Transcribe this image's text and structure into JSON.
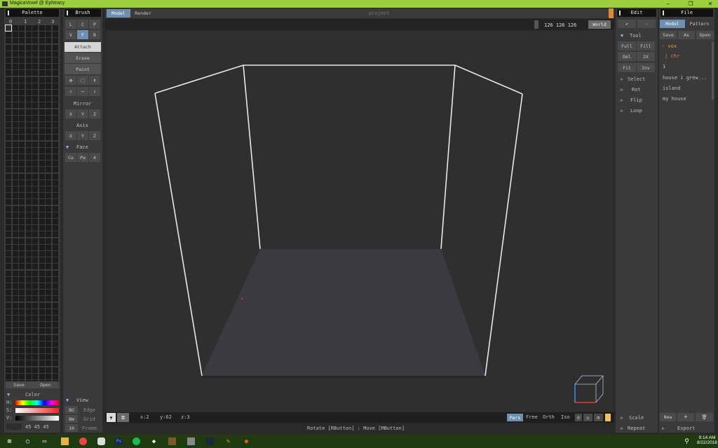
{
  "window": {
    "title": "MagicaVoxel @ Ephtracy",
    "minimize": "–",
    "maximize": "❐",
    "close": "✕"
  },
  "palette": {
    "title": "Palette",
    "tabs": [
      "0",
      "1",
      "2",
      "3"
    ],
    "save": "Save",
    "open": "Open"
  },
  "color": {
    "title": "Color",
    "h": "H:",
    "s": "S:",
    "v": "V:",
    "rgb": "45 45 45"
  },
  "brush": {
    "title": "Brush",
    "row1": [
      "L",
      "C",
      "P"
    ],
    "row2": [
      "V",
      "F",
      "B"
    ],
    "modes": [
      "Attach",
      "Erase",
      "Paint"
    ],
    "mirror": "Mirror",
    "mirror_axes": [
      "X",
      "Y",
      "Z"
    ],
    "axis": "Axis",
    "axis_axes": [
      "X",
      "Y",
      "Z"
    ],
    "face": "Face",
    "face_btns": [
      "Co",
      "Pa",
      "4"
    ]
  },
  "view": {
    "title": "View",
    "rows": [
      {
        "k": "BG",
        "v": "Edge"
      },
      {
        "k": "BW",
        "v": "Grid"
      },
      {
        "k": "10",
        "v": "Frame"
      }
    ]
  },
  "tabs": {
    "model": "Model",
    "render": "Render",
    "project": "project"
  },
  "size": {
    "value": "126 126 126",
    "world": "World"
  },
  "status": {
    "x": "x:2",
    "y": "y:62",
    "z": "z:3",
    "hint": "Rotate [RButton] : Move [MButton]"
  },
  "cam": {
    "pers": "Pers",
    "free": "Free",
    "orth": "Orth",
    "iso": "Iso",
    "zero": "0"
  },
  "edit": {
    "title": "Edit",
    "tool": "Tool",
    "grid": [
      "Full",
      "Fill",
      "Del",
      "2X",
      "Fit",
      "Inv"
    ],
    "items": [
      "Select",
      "Rot",
      "Flip",
      "Loop"
    ],
    "scale": "Scale",
    "repeat": "Repeat"
  },
  "file": {
    "title": "File",
    "tabs": [
      "Model",
      "Pattern"
    ],
    "btns": [
      "Save",
      "As",
      "Open"
    ],
    "list": [
      "- vox",
      "| chr",
      "1",
      "house i grew...",
      "island",
      "my house"
    ],
    "new": "New",
    "plus": "+",
    "export": "Export"
  },
  "taskbar": {
    "time": "9:14 AM",
    "date": "8/22/2018"
  },
  "colors": {
    "accent": "#6f8fb0",
    "titlebar": "#9ccf3c",
    "orange": "#e0883a"
  }
}
